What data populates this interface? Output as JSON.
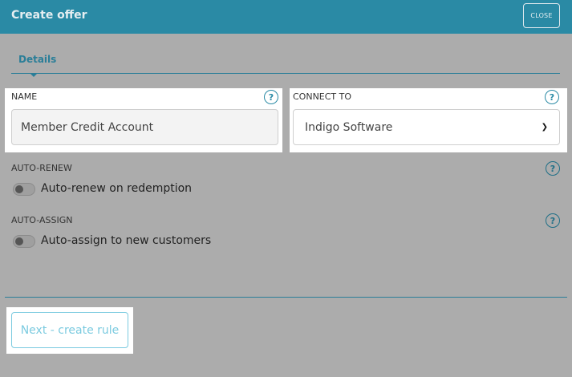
{
  "header": {
    "title": "Create offer",
    "close_label": "CLOSE"
  },
  "tabs": [
    {
      "label": "Details"
    }
  ],
  "form": {
    "name": {
      "label": "NAME",
      "value": "Member Credit Account",
      "help": "?"
    },
    "connect_to": {
      "label": "CONNECT TO",
      "selected": "Indigo Software",
      "help": "?"
    },
    "auto_renew": {
      "label": "AUTO-RENEW",
      "toggle_label": "Auto-renew on redemption",
      "enabled": false,
      "help": "?"
    },
    "auto_assign": {
      "label": "AUTO-ASSIGN",
      "toggle_label": "Auto-assign to new customers",
      "enabled": false,
      "help": "?"
    }
  },
  "footer": {
    "next_label": "Next - create rule"
  },
  "colors": {
    "accent": "#2a8aa5",
    "backdrop": "#acacac",
    "disabled_button_text": "#7ccbe0"
  }
}
